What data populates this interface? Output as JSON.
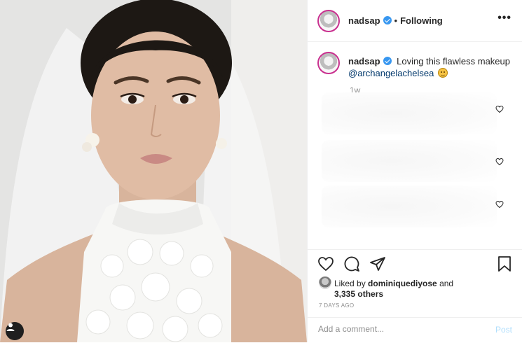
{
  "header": {
    "username": "nadsap",
    "separator": "•",
    "follow_status": "Following",
    "more_label": "•••"
  },
  "caption": {
    "username": "nadsap",
    "text": "Loving this flawless makeup",
    "mention": "@archangelachelsea",
    "time": "1w"
  },
  "likes": {
    "prefix": "Liked by",
    "liker": "dominiquediyose",
    "suffix": "and",
    "others": "3,335 others"
  },
  "date": "7 DAYS AGO",
  "comment_box": {
    "placeholder": "Add a comment...",
    "post_label": "Post"
  },
  "colors": {
    "verified": "#3897f0",
    "mention": "#00376b",
    "post_disabled": "#b2dffc",
    "muted": "#8e8e8e"
  },
  "icons": [
    "heart-icon",
    "comment-icon",
    "share-icon",
    "bookmark-icon",
    "user-tag-icon",
    "verified-badge-icon"
  ]
}
